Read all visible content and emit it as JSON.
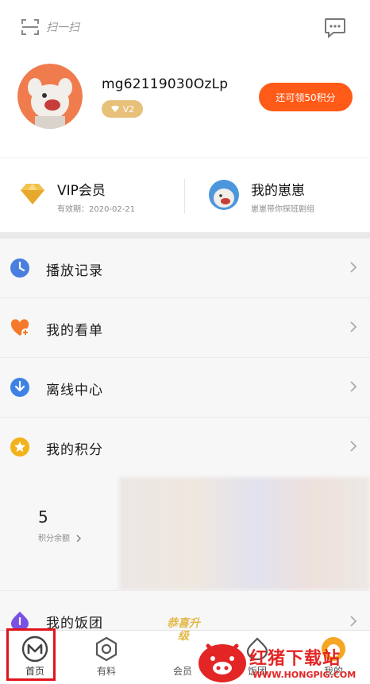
{
  "header": {
    "scan_label": "扫一扫"
  },
  "profile": {
    "username": "mg62119030OzLp",
    "level_badge": "V2",
    "earn_button": "还可领50积分"
  },
  "vip": {
    "title": "VIP会员",
    "expiry": "有效期：2020-02-21"
  },
  "mangocard": {
    "title": "我的崽崽",
    "subtitle": "崽崽带你探班剧组"
  },
  "menu": {
    "items": [
      {
        "label": "播放记录",
        "icon": "clock-icon",
        "color": "#4a7fe0"
      },
      {
        "label": "我的看单",
        "icon": "heart-plus-icon",
        "color": "#f4792a"
      },
      {
        "label": "离线中心",
        "icon": "download-icon",
        "color": "#3f82e6"
      },
      {
        "label": "我的积分",
        "icon": "star-coin-icon",
        "color": "#f3b21b"
      }
    ],
    "fantuan": {
      "label": "我的饭团",
      "icon": "fantuan-icon",
      "color": "#7a52e3"
    }
  },
  "points": {
    "balance": "5",
    "balance_label": "积分余额"
  },
  "tabbar": {
    "home": "首页",
    "youliao": "有料",
    "vip": "会员",
    "vip_promo": "恭喜升级",
    "fantuan": "饭团",
    "mine": "我的"
  },
  "watermark": {
    "text": "红猪下载站",
    "url": "WWW.HONGPIG.COM"
  },
  "colors": {
    "accent": "#ff5a18",
    "gold": "#e7c07a",
    "highlight": "#e0141e"
  }
}
